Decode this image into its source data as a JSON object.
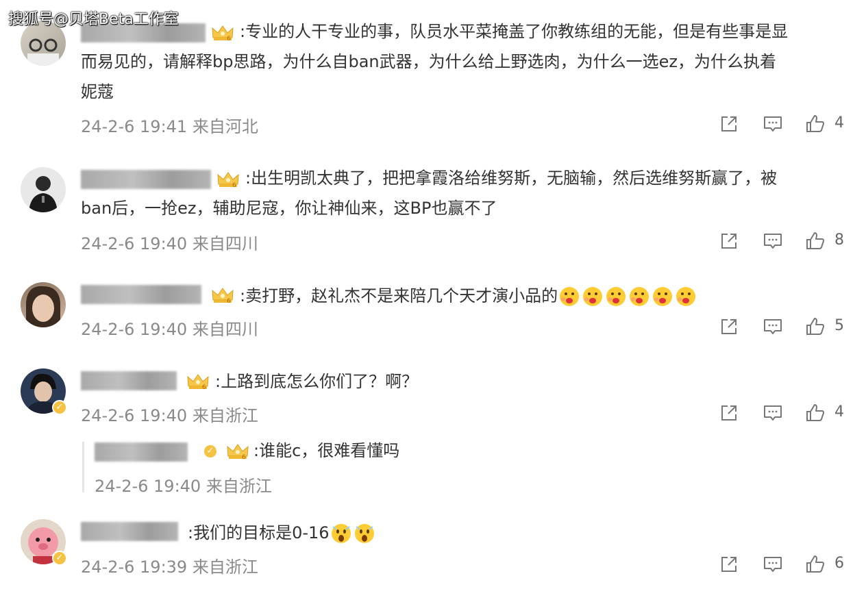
{
  "watermark": "搜狐号@贝塔Beta工作室",
  "comments": [
    {
      "text": ":专业的人干专业的事，队员水平菜掩盖了你教练组的无能，但是有些事是显\n而易见的，请解释bp思路，为什么自ban武器，为什么给上野选肉，为什么一选ez，为什么执着\n妮蔻",
      "time": "24-2-6 19:41 来自河北",
      "likes": "4"
    },
    {
      "text": ":出生明凯太典了，把把拿霞洛给维努斯，无脑输，然后选维努斯赢了，被\nban后，一抢ez，辅助尼寇，你让神仙来，这BP也赢不了",
      "time": "24-2-6 19:40 来自四川",
      "likes": "8"
    },
    {
      "text": ":卖打野，赵礼杰不是来陪几个天才演小品的",
      "time": "24-2-6 19:40 来自四川",
      "likes": "5"
    },
    {
      "text": ":上路到底怎么你们了？啊？",
      "time": "24-2-6 19:40 来自浙江",
      "likes": "4"
    },
    {
      "text": ":谁能c，很难看懂吗",
      "time": "24-2-6 19:40 来自浙江",
      "likes": ""
    },
    {
      "text": ":我们的目标是0-16",
      "time": "24-2-6 19:39 来自浙江",
      "likes": "6"
    }
  ],
  "icons": {
    "share": "share-icon",
    "comment": "comment-icon",
    "like": "like-icon",
    "badge": "crown-badge-icon",
    "verified": "verified-badge-icon",
    "emoji1": "thinking-face-emoji",
    "emoji2": "scared-face-emoji"
  },
  "colors": {
    "meta": "#8a8a8a",
    "badge_gold": "#f5c242"
  }
}
